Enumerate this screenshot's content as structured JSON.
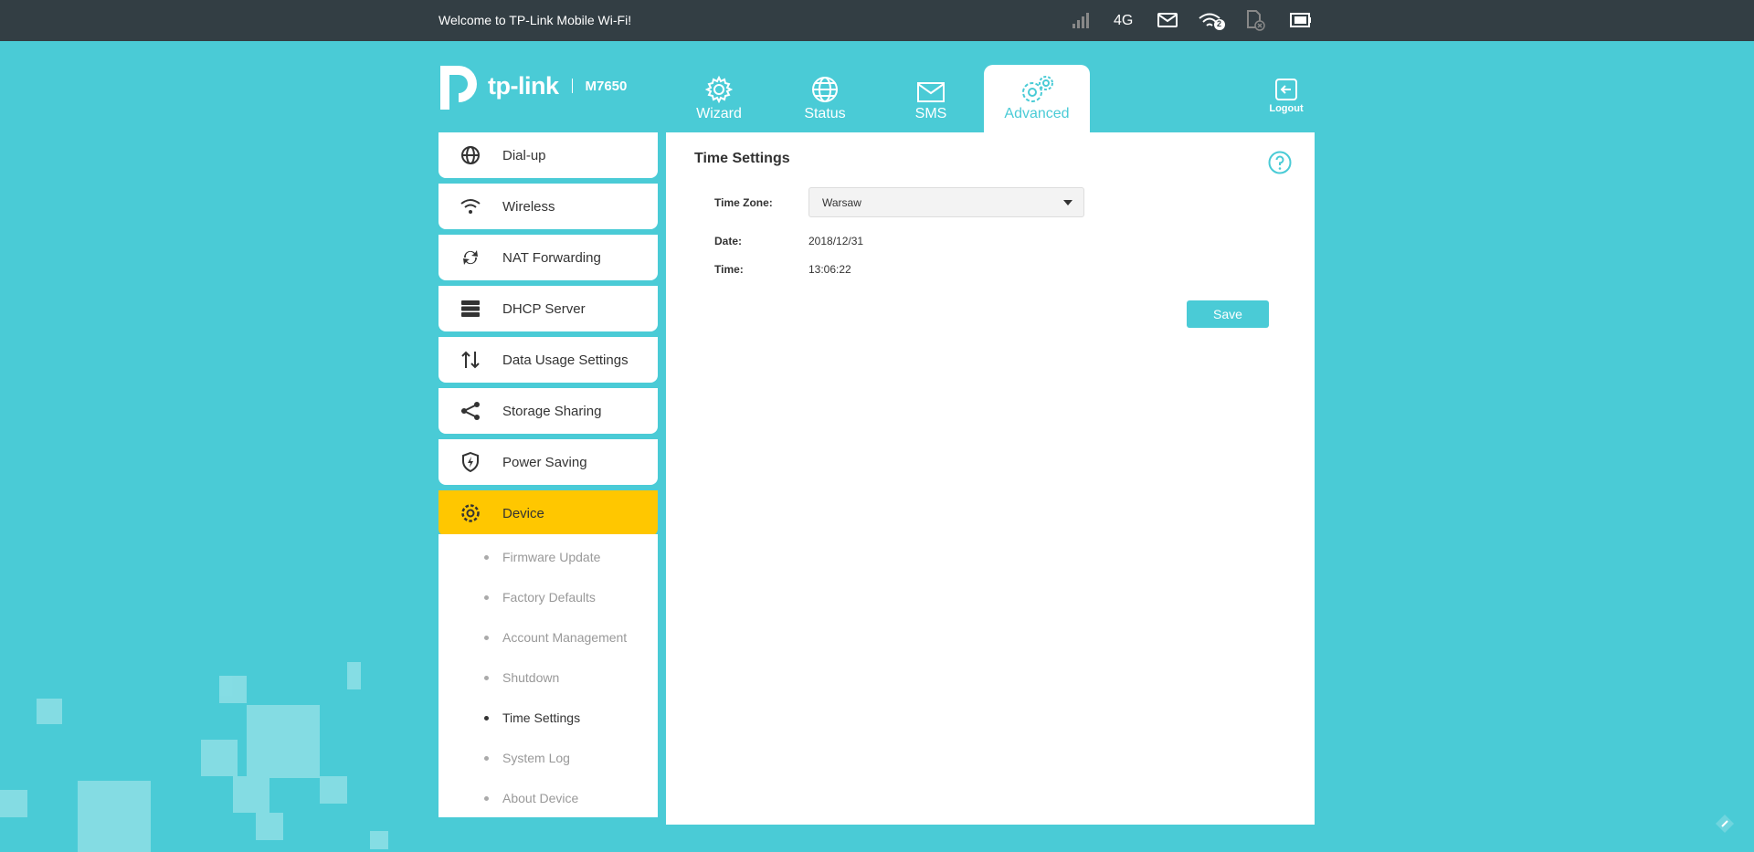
{
  "topbar": {
    "welcome": "Welcome to TP-Link Mobile Wi-Fi!",
    "network_type": "4G",
    "wifi_clients": "2",
    "icons": [
      "signal-icon",
      "mail-icon",
      "wifi-icon",
      "sim-card-icon",
      "battery-icon"
    ]
  },
  "header": {
    "brand": "tp-link",
    "model": "M7650",
    "tabs": [
      {
        "label": "Wizard",
        "icon": "gear-icon"
      },
      {
        "label": "Status",
        "icon": "globe-icon"
      },
      {
        "label": "SMS",
        "icon": "mail-icon"
      },
      {
        "label": "Advanced",
        "icon": "gears-icon",
        "active": true
      }
    ],
    "logout": "Logout"
  },
  "sidebar": {
    "items": [
      {
        "label": "Dial-up",
        "icon": "globe-icon"
      },
      {
        "label": "Wireless",
        "icon": "wifi-icon"
      },
      {
        "label": "NAT Forwarding",
        "icon": "refresh-icon"
      },
      {
        "label": "DHCP Server",
        "icon": "server-icon"
      },
      {
        "label": "Data Usage Settings",
        "icon": "updown-arrows-icon"
      },
      {
        "label": "Storage Sharing",
        "icon": "share-icon"
      },
      {
        "label": "Power Saving",
        "icon": "shield-icon"
      },
      {
        "label": "Device",
        "icon": "gear-icon",
        "active": true
      }
    ],
    "sub_items": [
      {
        "label": "Firmware Update"
      },
      {
        "label": "Factory Defaults"
      },
      {
        "label": "Account Management"
      },
      {
        "label": "Shutdown"
      },
      {
        "label": "Time Settings",
        "current": true
      },
      {
        "label": "System Log"
      },
      {
        "label": "About Device"
      }
    ]
  },
  "main": {
    "title": "Time Settings",
    "timezone_label": "Time Zone:",
    "timezone_value": "Warsaw",
    "date_label": "Date:",
    "date_value": "2018/12/31",
    "time_label": "Time:",
    "time_value": "13:06:22",
    "save_label": "Save"
  },
  "colors": {
    "accent": "#4acbd6",
    "topbar": "#333e44",
    "active_menu": "#ffc700"
  }
}
